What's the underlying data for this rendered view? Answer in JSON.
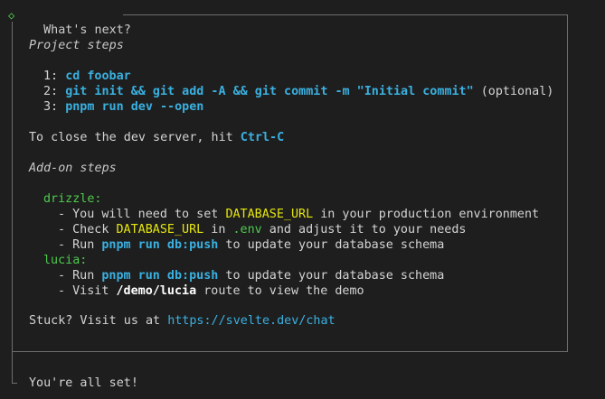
{
  "header": {
    "title": "What's next?"
  },
  "project_steps": {
    "heading": "Project steps",
    "steps": [
      {
        "num": "1:",
        "cmd": "cd foobar",
        "suffix": ""
      },
      {
        "num": "2:",
        "cmd": "git init && git add -A && git commit -m \"Initial commit\"",
        "suffix": " (optional)"
      },
      {
        "num": "3:",
        "cmd": "pnpm run dev --open",
        "suffix": ""
      }
    ]
  },
  "close_server": {
    "prefix": "To close the dev server, hit ",
    "key": "Ctrl-C"
  },
  "addon_steps": {
    "heading": "Add-on steps",
    "drizzle": {
      "name": "drizzle:",
      "line1_prefix": "- You will need to set ",
      "line1_var": "DATABASE_URL",
      "line1_suffix": " in your production environment",
      "line2_prefix": "- Check ",
      "line2_var": "DATABASE_URL",
      "line2_mid": " in ",
      "line2_file": ".env",
      "line2_suffix": " and adjust it to your needs",
      "line3_prefix": "- Run ",
      "line3_cmd": "pnpm run db:push",
      "line3_suffix": " to update your database schema"
    },
    "lucia": {
      "name": "lucia:",
      "line1_prefix": "- Run ",
      "line1_cmd": "pnpm run db:push",
      "line1_suffix": " to update your database schema",
      "line2_prefix": "- Visit ",
      "line2_route": "/demo/lucia",
      "line2_suffix": " route to view the demo"
    }
  },
  "help": {
    "prefix": "Stuck? Visit us at ",
    "link": "https://svelte.dev/chat"
  },
  "footer": {
    "text": "You're all set!"
  }
}
